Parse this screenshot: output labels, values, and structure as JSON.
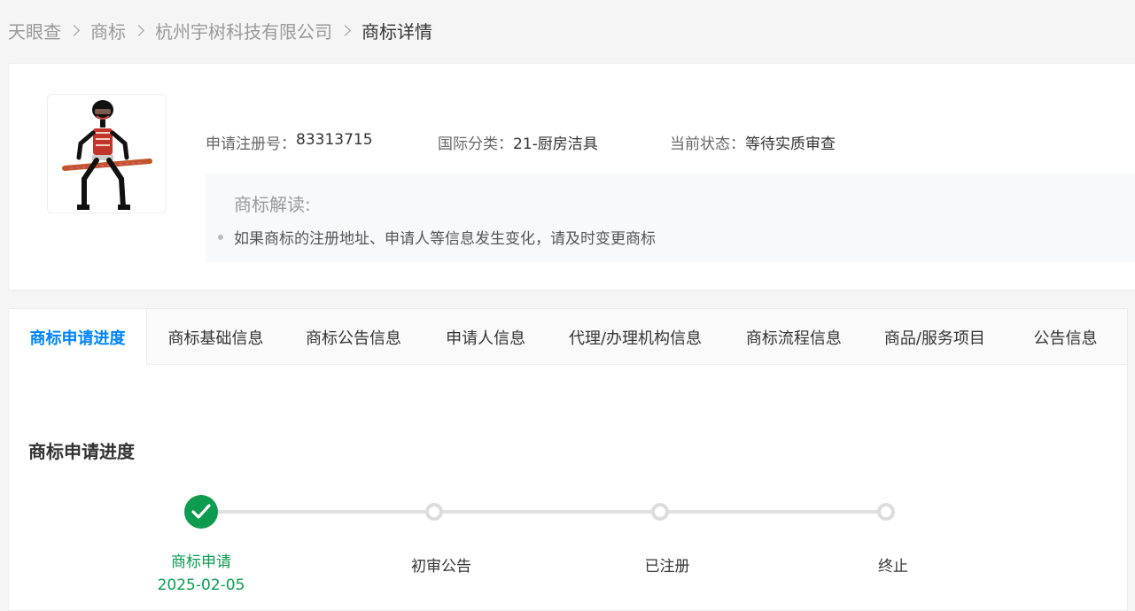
{
  "breadcrumb": {
    "items": [
      "天眼查",
      "商标",
      "杭州宇树科技有限公司",
      "商标详情"
    ]
  },
  "trademark": {
    "logo_icon": "robot-figure-trademark-image",
    "reg_no_label": "申请注册号：",
    "reg_no": "83313715",
    "class_label": "国际分类：",
    "class_value": "21-厨房洁具",
    "status_label": "当前状态：",
    "status_value": "等待实质审查"
  },
  "interpretation": {
    "title": "商标解读:",
    "items": [
      "如果商标的注册地址、申请人等信息发生变化，请及时变更商标"
    ]
  },
  "tabs": [
    {
      "label": "商标申请进度",
      "active": true
    },
    {
      "label": "商标基础信息"
    },
    {
      "label": "商标公告信息"
    },
    {
      "label": "申请人信息"
    },
    {
      "label": "代理/办理机构信息"
    },
    {
      "label": "商标流程信息"
    },
    {
      "label": "商品/服务项目"
    },
    {
      "label": "公告信息"
    }
  ],
  "progress": {
    "title": "商标申请进度",
    "steps": [
      {
        "label": "商标申请",
        "date": "2025-02-05",
        "done": true
      },
      {
        "label": "初审公告",
        "done": false
      },
      {
        "label": "已注册",
        "done": false
      },
      {
        "label": "终止",
        "done": false
      }
    ]
  },
  "colors": {
    "accent": "#0084ff",
    "done": "#0c9b4f",
    "track": "#e0e0e0"
  }
}
